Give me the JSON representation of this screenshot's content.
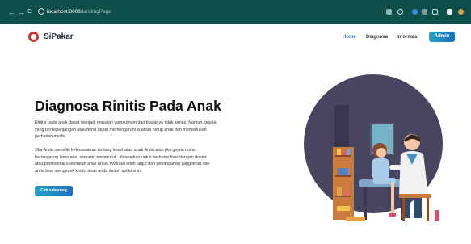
{
  "browser": {
    "back": "←",
    "forward": "→",
    "reload": "C",
    "url_host": "localhost:8003",
    "url_path": "/landingPage"
  },
  "header": {
    "brand": "SiPakar",
    "nav": [
      "Home",
      "Diagnosa",
      "Informasi"
    ],
    "admin": "Admin"
  },
  "hero": {
    "title": "Diagnosa Rinitis Pada Anak",
    "para1_lines": [
      "Rinitis pada anak dapat menjadi masalah yang umum dan biasanya tidak serius. Namun, gejala",
      "yang berkepanjangan atau berat dapat memengaruhi kualitas hidup anak dan memerlukan",
      "perhatian medis."
    ],
    "para2_lines": [
      "Jika Anda memiliki kekhawatiran tentang kesehatan anak Anda atau jika gejala rinitis",
      "berlangsung lama atau semakin memburuk, disarankan untuk berkonsultasi dengan dokter",
      "atau profesional kesehatan anak untuk evaluasi lebih lanjut dan penanganan yang tepat dan",
      "anda bisa mengecek kodisi anak anda dalam aplikasi ini."
    ],
    "cta": "Cek sekarang"
  },
  "colors": {
    "chrome": "#0f4f4b",
    "accent_start": "#1fa5c6",
    "accent_end": "#1f6fbf",
    "illustration_circle": "#474560"
  }
}
